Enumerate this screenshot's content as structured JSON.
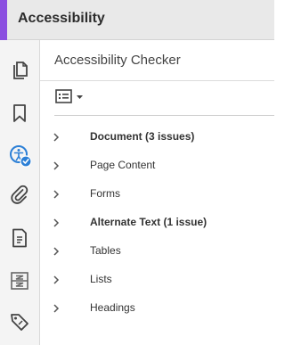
{
  "header": {
    "title": "Accessibility",
    "accent_color": "#8b4fe0"
  },
  "rail": {
    "tools": [
      {
        "name": "pages",
        "icon": "pages-icon"
      },
      {
        "name": "bookmarks",
        "icon": "bookmark-icon"
      },
      {
        "name": "accessibility",
        "icon": "accessibility-check-icon",
        "active": true
      },
      {
        "name": "attachments",
        "icon": "paperclip-icon"
      },
      {
        "name": "document",
        "icon": "document-icon"
      },
      {
        "name": "compare",
        "icon": "compare-icon"
      },
      {
        "name": "tags",
        "icon": "tag-icon"
      }
    ]
  },
  "panel": {
    "title": "Accessibility Checker",
    "options_icon": "options-list-icon",
    "items": [
      {
        "label": "Document (3 issues)",
        "bold": true
      },
      {
        "label": "Page Content",
        "bold": false
      },
      {
        "label": "Forms",
        "bold": false
      },
      {
        "label": "Alternate Text (1 issue)",
        "bold": true
      },
      {
        "label": "Tables",
        "bold": false
      },
      {
        "label": "Lists",
        "bold": false
      },
      {
        "label": "Headings",
        "bold": false
      }
    ]
  }
}
